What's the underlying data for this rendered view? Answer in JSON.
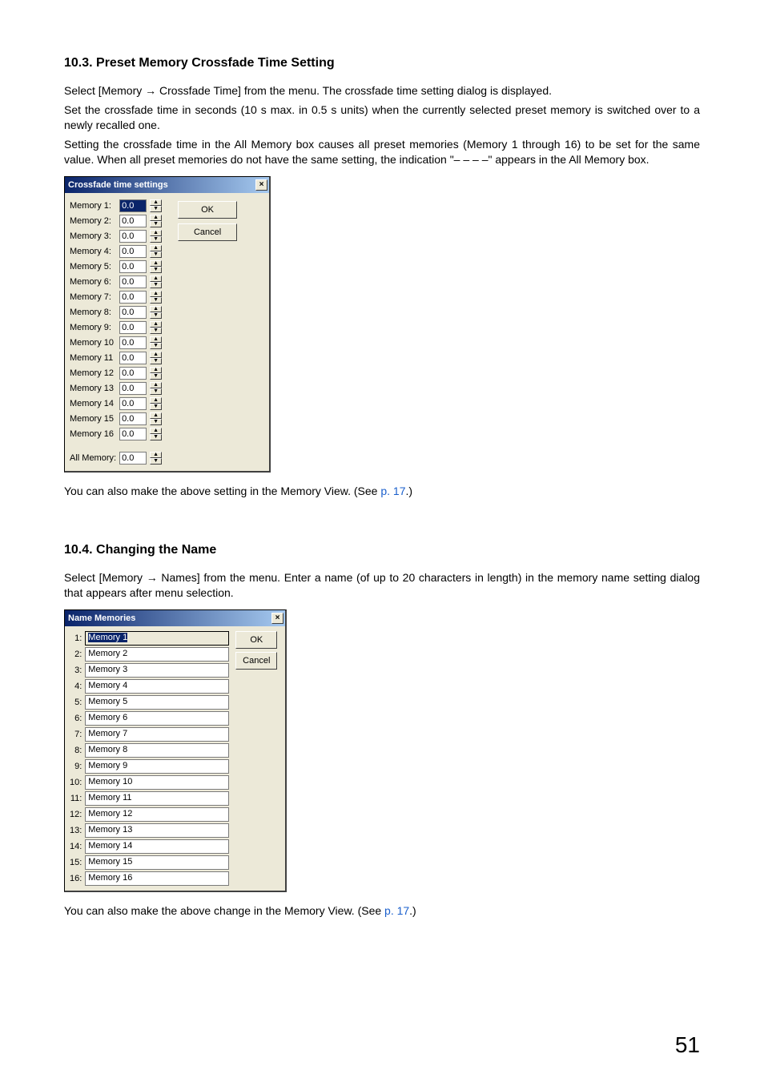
{
  "section103": {
    "heading": "10.3. Preset Memory Crossfade Time Setting",
    "p1": "Select [Memory → Crossfade Time] from the menu. The crossfade time setting dialog is displayed.",
    "p2": "Set the crossfade time in seconds (10 s max. in 0.5 s units) when the currently selected preset memory is switched over to a newly recalled one.",
    "p3": "Setting the crossfade time in the All Memory box causes all preset memories (Memory 1 through 16) to be set for the same value. When all preset memories do not have the same setting, the indication \"– – – –\" appears in the All Memory box.",
    "note_pre": "You can also make the above setting in the Memory View. (See ",
    "note_link": "p. 17",
    "note_post": ".)"
  },
  "crossfade_dialog": {
    "title": "Crossfade time settings",
    "close_glyph": "×",
    "ok": "OK",
    "cancel": "Cancel",
    "items": [
      {
        "label": "Memory 1:",
        "value": "0.0",
        "selected": true
      },
      {
        "label": "Memory 2:",
        "value": "0.0"
      },
      {
        "label": "Memory 3:",
        "value": "0.0"
      },
      {
        "label": "Memory 4:",
        "value": "0.0"
      },
      {
        "label": "Memory 5:",
        "value": "0.0"
      },
      {
        "label": "Memory 6:",
        "value": "0.0"
      },
      {
        "label": "Memory 7:",
        "value": "0.0"
      },
      {
        "label": "Memory 8:",
        "value": "0.0"
      },
      {
        "label": "Memory 9:",
        "value": "0.0"
      },
      {
        "label": "Memory 10",
        "value": "0.0"
      },
      {
        "label": "Memory 11",
        "value": "0.0"
      },
      {
        "label": "Memory 12",
        "value": "0.0"
      },
      {
        "label": "Memory 13",
        "value": "0.0"
      },
      {
        "label": "Memory 14",
        "value": "0.0"
      },
      {
        "label": "Memory 15",
        "value": "0.0"
      },
      {
        "label": "Memory 16",
        "value": "0.0"
      }
    ],
    "all_label": "All Memory:",
    "all_value": "0.0",
    "spin_up": "▲",
    "spin_down": "▼"
  },
  "section104": {
    "heading": "10.4. Changing the Name",
    "p1": "Select [Memory → Names] from the menu. Enter a name (of up to 20 characters in length) in the memory name setting dialog that appears after menu selection.",
    "note_pre": "You can also make the above change in the Memory View. (See ",
    "note_link": "p. 17",
    "note_post": ".)"
  },
  "names_dialog": {
    "title": "Name Memories",
    "close_glyph": "×",
    "ok": "OK",
    "cancel": "Cancel",
    "items": [
      {
        "idx": "1:",
        "value": "Memory 1",
        "selected": true
      },
      {
        "idx": "2:",
        "value": "Memory 2"
      },
      {
        "idx": "3:",
        "value": "Memory 3"
      },
      {
        "idx": "4:",
        "value": "Memory 4"
      },
      {
        "idx": "5:",
        "value": "Memory 5"
      },
      {
        "idx": "6:",
        "value": "Memory 6"
      },
      {
        "idx": "7:",
        "value": "Memory 7"
      },
      {
        "idx": "8:",
        "value": "Memory 8"
      },
      {
        "idx": "9:",
        "value": "Memory 9"
      },
      {
        "idx": "10:",
        "value": "Memory 10"
      },
      {
        "idx": "11:",
        "value": "Memory 11"
      },
      {
        "idx": "12:",
        "value": "Memory 12"
      },
      {
        "idx": "13:",
        "value": "Memory 13"
      },
      {
        "idx": "14:",
        "value": "Memory 14"
      },
      {
        "idx": "15:",
        "value": "Memory 15"
      },
      {
        "idx": "16:",
        "value": "Memory 16"
      }
    ]
  },
  "page_number": "51"
}
